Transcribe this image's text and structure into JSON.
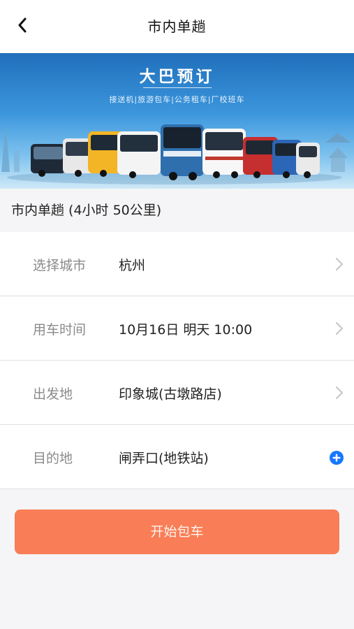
{
  "nav": {
    "title": "市内单趟"
  },
  "banner": {
    "title": "大巴预订",
    "subtitle": "接送机|旅游包车|公务租车|厂校班车"
  },
  "section": {
    "title": "市内单趟 (4小时 50公里)"
  },
  "form": {
    "rows": [
      {
        "label": "选择城市",
        "value": "杭州",
        "action": "chevron-right-icon"
      },
      {
        "label": "用车时间",
        "value": "10月16日 明天 10:00",
        "action": "chevron-right-icon"
      },
      {
        "label": "出发地",
        "value": "印象城(古墩路店)",
        "action": "chevron-right-icon"
      },
      {
        "label": "目的地",
        "value": "闸弄口(地铁站)",
        "action": "add-stop-icon"
      }
    ]
  },
  "submit": {
    "label": "开始包车"
  },
  "colors": {
    "accent": "#f97d56",
    "plus_icon": "#1677ff",
    "banner_top": "#1f6fbb"
  }
}
